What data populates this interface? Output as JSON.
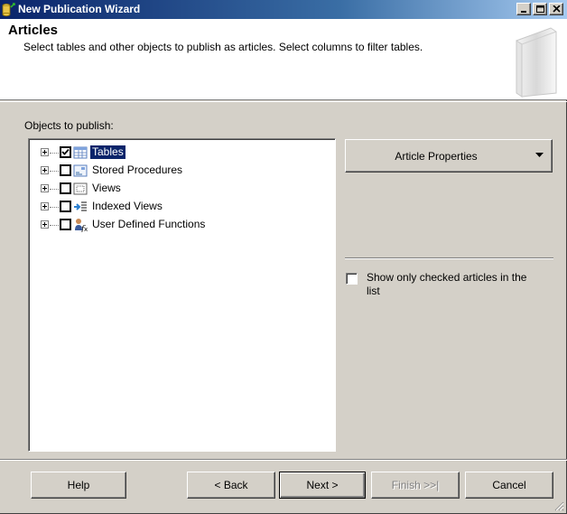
{
  "window": {
    "title": "New Publication Wizard",
    "controls": [
      "minimize",
      "maximize",
      "close"
    ]
  },
  "header": {
    "title": "Articles",
    "description": "Select tables and other objects to publish as articles. Select columns to filter tables."
  },
  "objects_label": "Objects to publish:",
  "tree": [
    {
      "label": "Tables",
      "checked": true,
      "selected": true,
      "icon": "table-icon"
    },
    {
      "label": "Stored Procedures",
      "checked": false,
      "selected": false,
      "icon": "stored-procedure-icon"
    },
    {
      "label": "Views",
      "checked": false,
      "selected": false,
      "icon": "view-icon"
    },
    {
      "label": "Indexed Views",
      "checked": false,
      "selected": false,
      "icon": "indexed-view-icon"
    },
    {
      "label": "User Defined Functions",
      "checked": false,
      "selected": false,
      "icon": "function-icon"
    }
  ],
  "article_properties_label": "Article Properties",
  "show_checked_label": "Show only checked articles in the list",
  "show_checked_value": false,
  "buttons": {
    "help": "Help",
    "back": "< Back",
    "next": "Next >",
    "finish": "Finish >>|",
    "cancel": "Cancel"
  },
  "colors": {
    "title_bar_start": "#0a246a",
    "title_bar_end": "#a6caf0",
    "face": "#d4d0c8",
    "selection": "#0a246a"
  }
}
